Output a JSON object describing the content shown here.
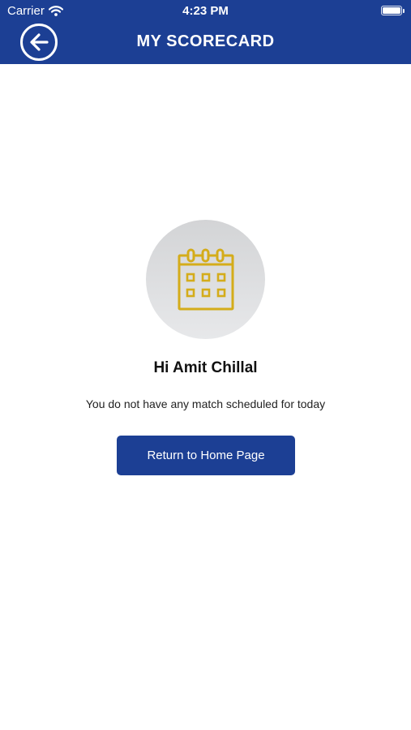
{
  "status_bar": {
    "carrier": "Carrier",
    "time": "4:23 PM"
  },
  "header": {
    "title": "MY SCORECARD",
    "back_icon": "arrow-left-circle-icon"
  },
  "main": {
    "icon": "calendar-icon",
    "icon_color": "#d4ac1a",
    "greeting": "Hi Amit Chillal",
    "message": "You do not have any match scheduled for today",
    "button_label": "Return to Home Page"
  },
  "colors": {
    "brand": "#1c3f94",
    "background": "#ffffff"
  }
}
